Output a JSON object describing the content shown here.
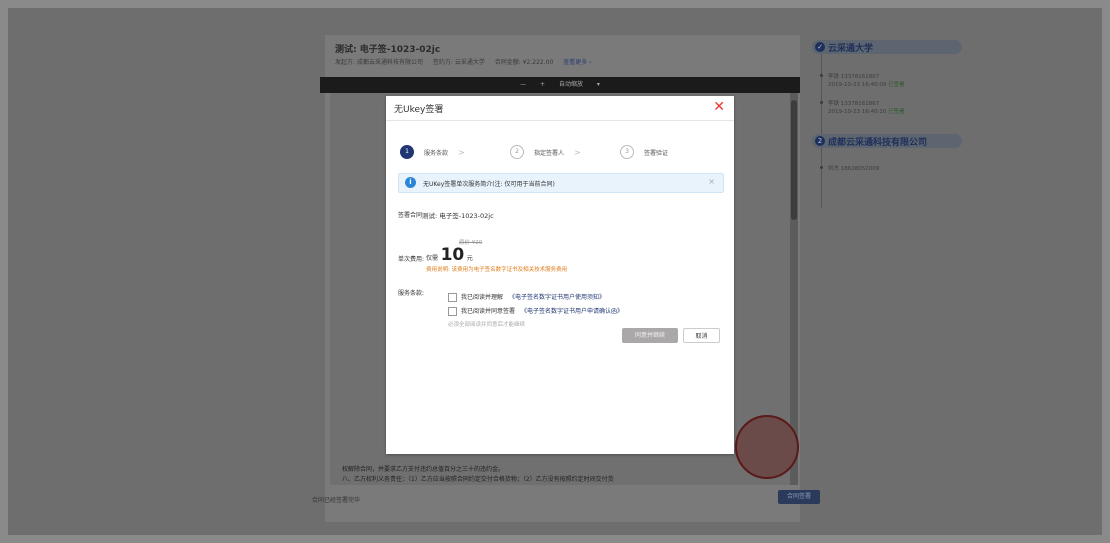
{
  "doc": {
    "title": "测试: 电子签-1023-02jc",
    "meta_sender_label": "发起方:",
    "meta_sender": "成都云采通科技有限公司",
    "meta_signer_label": "签约方:",
    "meta_signer": "云采通大学",
    "meta_amount_label": "合同金额:",
    "meta_amount": "¥2,222.00",
    "meta_more": "查看更多 ›",
    "toolbar_minus": "—",
    "toolbar_plus": "+",
    "toolbar_fit": "自动缩放",
    "toolbar_caret": "▾",
    "page_line_1": "权解除合同，并要求乙方支付违约总值百分之三十的违约金。",
    "page_line_2": "八、乙方权利义务责任：（1）乙方应当按照合同约定交付合格货物；（2）乙方没有按照约定时间交付货",
    "footer_left": "合同已经签署完毕",
    "footer_button": "合同签署"
  },
  "timeline": {
    "parties": [
      {
        "index": "✓",
        "name": "云采通大学"
      },
      {
        "index": "2",
        "name": "成都云采通科技有限公司"
      }
    ],
    "entries": [
      {
        "line1": "李铁 13378161867",
        "line2": "2019-10-23 16:40:09",
        "status": "已签署"
      },
      {
        "line1": "李铁 13378161867",
        "line2": "2019-10-23 16:40:10",
        "status": "已签署"
      },
      {
        "line1": "刘杰 18628052009",
        "line2": "",
        "status": ""
      }
    ]
  },
  "modal": {
    "title": "无Ukey签署",
    "close": "✕",
    "steps": [
      {
        "num": "1",
        "label": "服务条款",
        "chev": ">"
      },
      {
        "num": "2",
        "label": "指定签署人",
        "chev": ">"
      },
      {
        "num": "3",
        "label": "签署验证",
        "chev": ""
      }
    ],
    "info_icon": "i",
    "info_text": "无UKey签署单次服务简介(注: 仅可用于当前合同)",
    "info_close": "×",
    "contract_label": "签署合同:",
    "contract_value": "测试: 电子签-1023-02jc",
    "fee_label": "单次费用:",
    "original_price": "原价 ¥20",
    "price_prefix": "仅需",
    "price_value": "10",
    "price_unit": "元",
    "fee_note": "费用说明: 该费用为电子签名数字证书及相关技术服务费用",
    "terms_label": "服务条款:",
    "term1_text": "我已阅读并理解",
    "term1_link": "《电子签名数字证书用户使用须知》",
    "term2_text": "我已阅读并同意签署",
    "term2_link": "《电子签名数字证书用户申请确认函》",
    "terms_hint": "必须全部阅读并同意后才能继续",
    "agree_button": "同意并继续",
    "cancel_button": "取消"
  }
}
